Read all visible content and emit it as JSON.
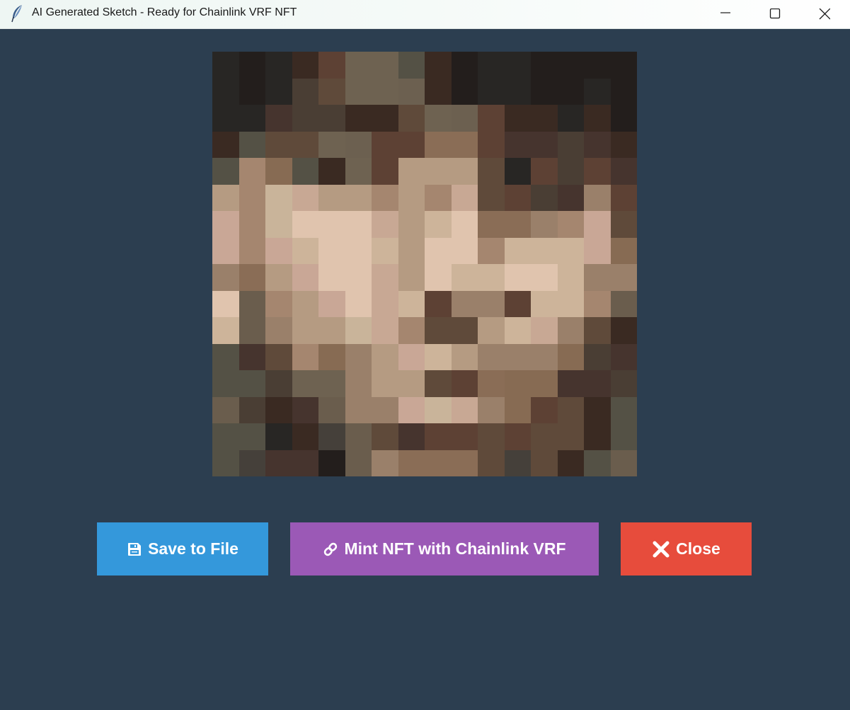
{
  "window": {
    "title": "AI Generated Sketch - Ready for Chainlink VRF NFT",
    "app_icon": "feather-icon",
    "controls": [
      "minimize-icon",
      "maximize-icon",
      "close-icon"
    ]
  },
  "buttons": {
    "save": {
      "label": "Save to File",
      "icon": "floppy-disk-icon",
      "color": "#3498db"
    },
    "mint": {
      "label": "Mint NFT with Chainlink VRF",
      "icon": "link-icon",
      "color": "#9b59b6"
    },
    "close": {
      "label": "Close",
      "icon": "x-icon",
      "color": "#e74c3c"
    }
  },
  "background_color": "#2c3e50",
  "sketch": {
    "grid": "16x16 pixelated portrait",
    "palette": {
      "a": "#282624",
      "b": "#231e1c",
      "c": "#3a2a22",
      "d": "#46342e",
      "e": "#6e6251",
      "f": "#876b53",
      "g": "#545145",
      "h": "#4a3e34",
      "i": "#5f4a3a",
      "j": "#6c6050",
      "k": "#5d4134",
      "l": "#8a6d56",
      "m": "#a5866f",
      "n": "#c9b49a",
      "o": "#c8a894",
      "p": "#e0c4ae",
      "q": "#b59b82",
      "r": "#9a806a",
      "s": "#cdb49a",
      "t": "#c9a796",
      "u": "#45403a",
      "v": "#6a5d4d"
    },
    "rows": [
      "abackeegcbaabbbb",
      "abahieejcbaabbab",
      "aadhhcciejkccacb",
      "cgiiejkkllkddhdc",
      "gmfgcekqqqiakhkd",
      "qmnoqqmqmoikhdrk",
      "tmnpppoqspllrmti",
      "tmtsppsqppmssstf",
      "rlqtppoqpssppsrr",
      "pvmqtposkrrkssmv",
      "svrqqnomiiqsoric",
      "gdimfrqtsqrrrfhd",
      "ggheerqqiklffddh",
      "vhcdvrrtnorfkicg",
      "ggacuvidkkikiicg",
      "guddbvrllliuicgv"
    ]
  }
}
